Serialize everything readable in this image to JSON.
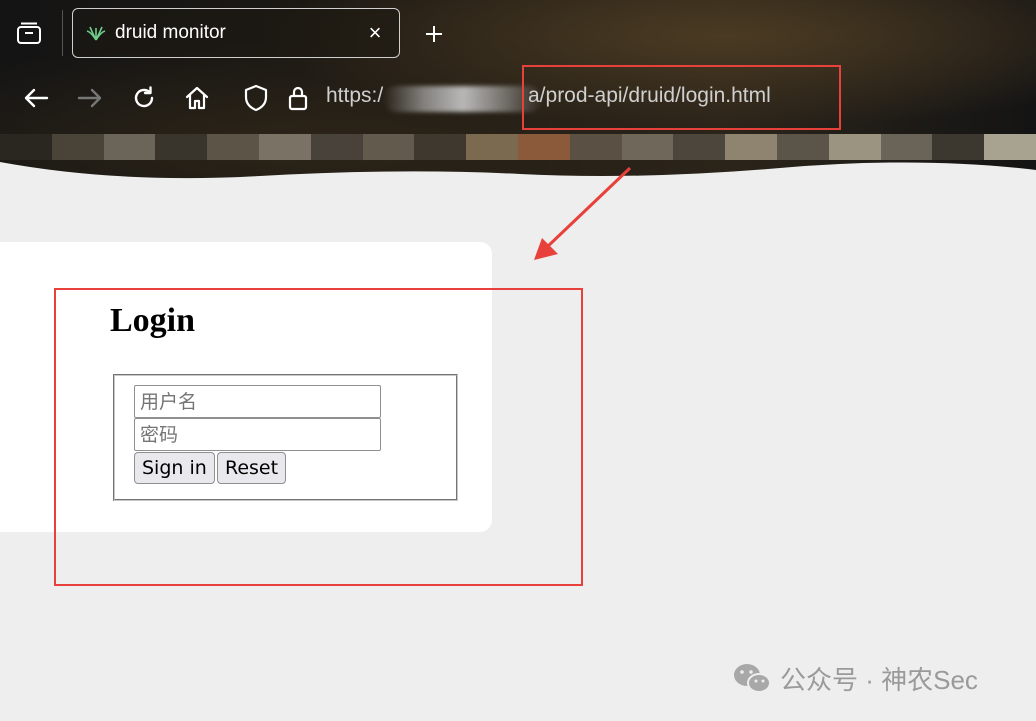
{
  "browser": {
    "tab": {
      "title": "druid monitor",
      "close_glyph": "×"
    },
    "new_tab_glyph": "+",
    "url": {
      "prefix": "https:/",
      "visible_path": "a/prod-api/druid/login.html"
    },
    "icons": {
      "tabs_overview": "tab-overview-icon",
      "back": "arrow-left-icon",
      "forward": "arrow-right-icon",
      "reload": "reload-icon",
      "home": "home-icon",
      "shield": "shield-icon",
      "lock": "lock-icon"
    }
  },
  "login": {
    "title": "Login",
    "username_placeholder": "用户名",
    "password_placeholder": "密码",
    "sign_in_label": "Sign in",
    "reset_label": "Reset"
  },
  "annotation": {
    "color": "#e8403a"
  },
  "watermark": {
    "text": "公众号 · 神农Sec"
  }
}
